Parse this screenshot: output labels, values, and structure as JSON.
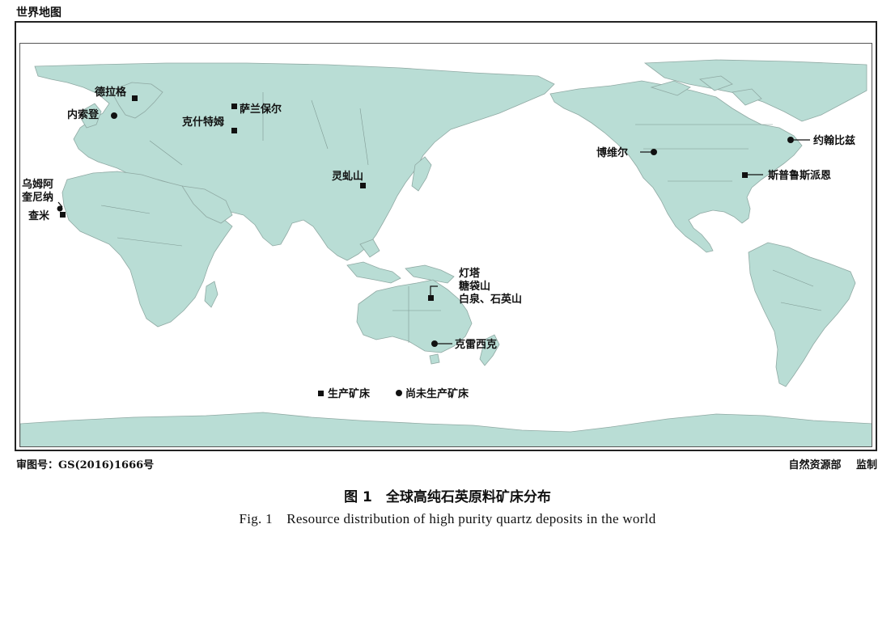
{
  "map": {
    "header": "世界地图",
    "approval_number": "审图号：GS(2016)1666号",
    "supervisor": "自然资源部 监制",
    "colors": {
      "land": "#b9ddd5",
      "ocean": "#ffffff",
      "marker": "#111111"
    },
    "deposits": [
      {
        "name": "德拉格",
        "status": "producing",
        "marker": "square"
      },
      {
        "name": "内索登",
        "status": "not-producing",
        "marker": "circle"
      },
      {
        "name": "萨兰保尔",
        "status": "producing",
        "marker": "square"
      },
      {
        "name": "克什特姆",
        "status": "producing",
        "marker": "square"
      },
      {
        "name": "乌姆阿奎尼纳",
        "status": "not-producing",
        "marker": "circle"
      },
      {
        "name": "查米",
        "status": "producing",
        "marker": "square"
      },
      {
        "name": "灵虬山",
        "status": "producing",
        "marker": "square"
      },
      {
        "name": "灯塔、糖袋山、白泉、石英山",
        "status": "producing",
        "marker": "square"
      },
      {
        "name": "克雷西克",
        "status": "not-producing",
        "marker": "circle"
      },
      {
        "name": "博维尔",
        "status": "not-producing",
        "marker": "circle"
      },
      {
        "name": "约翰比兹",
        "status": "not-producing",
        "marker": "circle"
      },
      {
        "name": "斯普鲁斯派恩",
        "status": "producing",
        "marker": "square"
      }
    ],
    "labels": {
      "draag": "德拉格",
      "nesodden": "内索登",
      "saranpaul": "萨兰保尔",
      "kyshtym": "克什特姆",
      "umm_line1": "乌姆阿",
      "umm_line2": "奎尼纳",
      "chami": "查米",
      "lingqiushan": "灵虬山",
      "aus_line1": "灯塔",
      "aus_line2": "糖袋山",
      "aus_line3": "白泉、石英山",
      "kresik": "克雷西克",
      "bovill": "博维尔",
      "johnbeads": "约翰比兹",
      "sprucepine": "斯普鲁斯派恩"
    },
    "legend": {
      "producing": "生产矿床",
      "not_producing": "尚未生产矿床"
    }
  },
  "caption": {
    "cn": "图 1　全球高纯石英原料矿床分布",
    "en": "Fig. 1　Resource distribution of high purity quartz deposits in the world"
  }
}
